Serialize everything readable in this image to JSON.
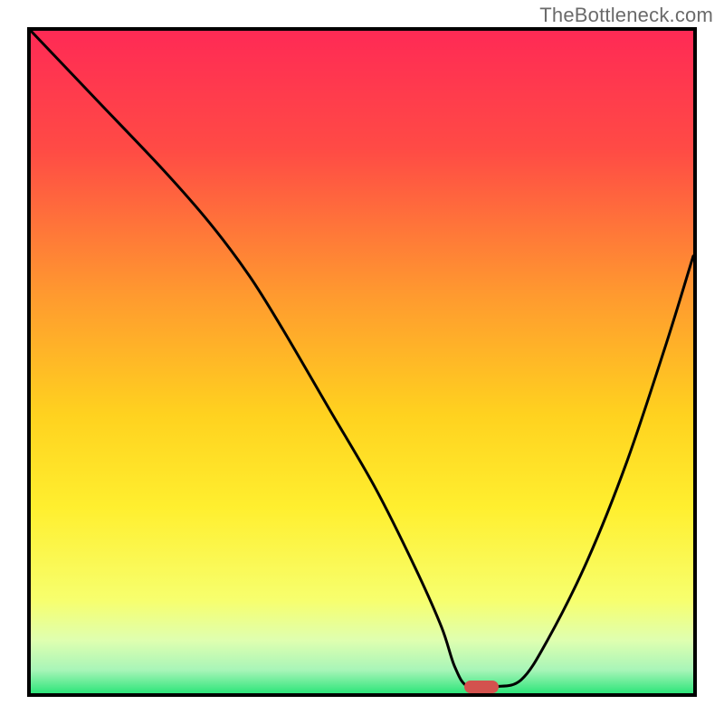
{
  "watermark": "TheBottleneck.com",
  "chart_data": {
    "type": "line",
    "title": "",
    "xlabel": "",
    "ylabel": "",
    "xlim": [
      0,
      100
    ],
    "ylim": [
      0,
      100
    ],
    "grid": false,
    "legend": false,
    "gradient_stops": [
      {
        "pct": 0,
        "color": "#ff2a55"
      },
      {
        "pct": 18,
        "color": "#ff4b45"
      },
      {
        "pct": 40,
        "color": "#ff9a2f"
      },
      {
        "pct": 58,
        "color": "#ffd21f"
      },
      {
        "pct": 72,
        "color": "#ffef2f"
      },
      {
        "pct": 86,
        "color": "#f7ff6e"
      },
      {
        "pct": 92,
        "color": "#dfffb0"
      },
      {
        "pct": 96.5,
        "color": "#a8f5b8"
      },
      {
        "pct": 100,
        "color": "#2ee57a"
      }
    ],
    "series": [
      {
        "name": "bottleneck-curve",
        "color": "#000000",
        "stroke_width": 3,
        "x": [
          0,
          10,
          20,
          27,
          33,
          38,
          45,
          52,
          58,
          62,
          64,
          66,
          70,
          74,
          78,
          84,
          90,
          96,
          100
        ],
        "values": [
          100,
          89.5,
          79,
          71,
          63,
          55,
          43,
          31,
          19,
          10,
          4,
          1,
          1,
          2,
          8,
          20,
          35,
          53,
          66
        ]
      }
    ],
    "marker": {
      "name": "optimal-point",
      "x": 68,
      "y": 1,
      "color": "#d3524e",
      "shape": "pill"
    }
  }
}
